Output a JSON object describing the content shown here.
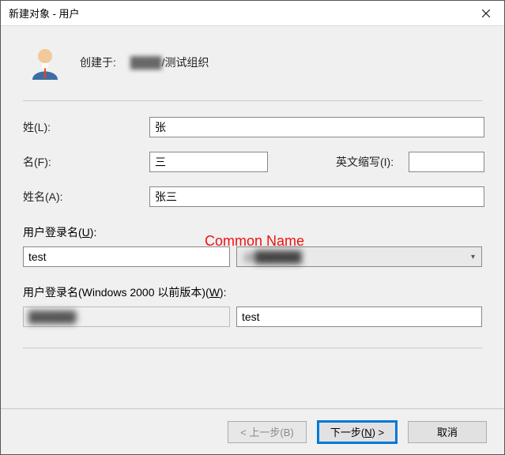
{
  "title": "新建对象 - 用户",
  "header": {
    "created_label": "创建于:",
    "path_blur": "████",
    "path_suffix": "/测试组织"
  },
  "fields": {
    "surname": {
      "label": "姓(L):",
      "value": "张"
    },
    "given": {
      "label": "名(F):",
      "value": "三"
    },
    "initials": {
      "label": "英文缩写(I):",
      "value": ""
    },
    "fullname": {
      "label": "姓名(A):",
      "value": "张三"
    }
  },
  "login": {
    "upn_label": "用户登录名(U):",
    "upn_value": "test",
    "domain_value": "@██████",
    "pre2k_label": "用户登录名(Windows 2000 以前版本)(W):",
    "pre2k_domain": "██████\\",
    "pre2k_value": "test"
  },
  "annotation": "Common Name",
  "buttons": {
    "back": "< 上一步(B)",
    "next_prefix": "下一步(",
    "next_hot": "N",
    "next_suffix": ") >",
    "cancel": "取消"
  }
}
